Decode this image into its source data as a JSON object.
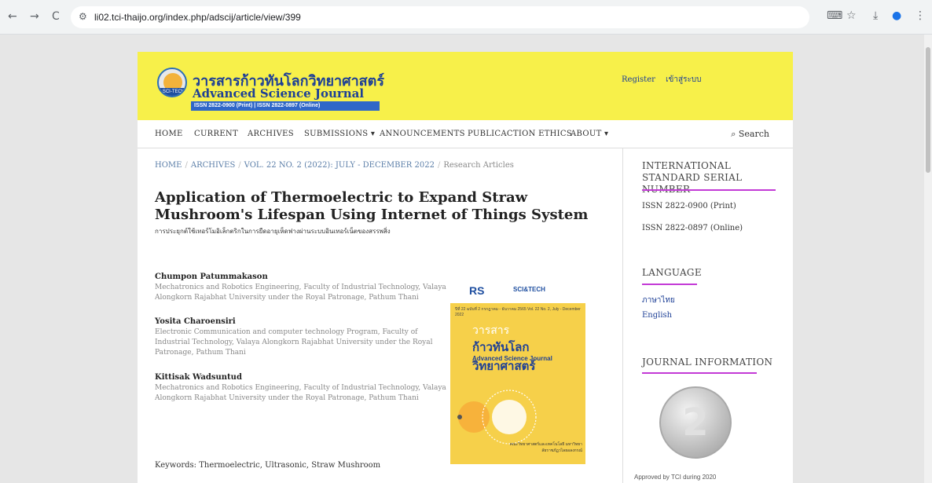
{
  "browser": {
    "url": "li02.tci-thaijo.org/index.php/adscij/article/view/399",
    "back_icon": "←",
    "forward_icon": "→",
    "reload_icon": "C",
    "tune_icon": "⚙",
    "translate_icon": "⌨",
    "bookmark_icon": "☆",
    "download_icon": "⤓",
    "profile_icon": "●",
    "menu_icon": "⋮"
  },
  "header": {
    "title_th": "วารสารก้าวทันโลกวิทยาศาสตร์",
    "title_en": "Advanced Science Journal",
    "issn_line": "ISSN 2822-0900 (Print) | ISSN 2822-0897 (Online)",
    "logo_label": "SCI-TECH",
    "register": "Register",
    "login": "เข้าสู่ระบบ"
  },
  "nav": {
    "items": [
      "HOME",
      "CURRENT",
      "ARCHIVES",
      "SUBMISSIONS ▾",
      "ANNOUNCEMENTS",
      "PUBLICACTION ETHICS",
      "ABOUT ▾"
    ],
    "search": "Search",
    "search_icon": "⌕"
  },
  "breadcrumb": {
    "home": "HOME",
    "archives": "ARCHIVES",
    "issue": "VOL. 22 NO. 2 (2022): JULY - DECEMBER 2022",
    "section": "Research Articles"
  },
  "article": {
    "title": "Application of Thermoelectric to Expand Straw Mushroom's Lifespan Using Internet of Things System",
    "subtitle": "การประยุกต์ใช้เทอร์โมอิเล็กตริกในการยืดอายุเห็ดฟางผ่านระบบอินเทอร์เน็ตของสรรพสิ่ง",
    "authors": [
      {
        "name": "Chumpon Patummakason",
        "aff": "Mechatronics and Robotics Engineering, Faculty of Industrial Technology, Valaya Alongkorn Rajabhat University under the Royal Patronage, Pathum Thani"
      },
      {
        "name": "Yosita Charoensiri",
        "aff": "Electronic Communication and computer technology Program, Faculty of Industrial Technology, Valaya Alongkorn Rajabhat University under the Royal Patronage, Pathum Thani"
      },
      {
        "name": "Kittisak Wadsuntud",
        "aff": "Mechatronics and Robotics Engineering, Faculty of Industrial Technology, Valaya Alongkorn Rajabhat University under the Royal Patronage, Pathum Thani"
      }
    ],
    "keywords": "Keywords: Thermoelectric, Ultrasonic, Straw Mushroom"
  },
  "cover": {
    "logo1": "RS",
    "logo2": "SCI&TECH",
    "small": "ปีที่ 22 ฉบับที่ 2 กรกฎาคม - ธันวาคม 2565 Vol. 22 No. 2, July - December 2022",
    "th1": "วารสาร",
    "th2": "ก้าวทันโลกวิทยาศาสตร์",
    "en": "Advanced Science Journal",
    "foot": "คณะวิทยาศาสตร์และเทคโนโลยี มหาวิทยาลัยราชภัฏวไลยอลงกรณ์"
  },
  "sidebar": {
    "issn_head": "INTERNATIONAL STANDARD SERIAL NUMBER",
    "issn_print": "ISSN 2822-0900 (Print)",
    "issn_online": "ISSN 2822-0897 (Online)",
    "lang_head": "LANGUAGE",
    "lang_th": "ภาษาไทย",
    "lang_en": "English",
    "info_head": "JOURNAL INFORMATION",
    "medal_num": "2",
    "approved": "Approved by TCI during 2020"
  }
}
